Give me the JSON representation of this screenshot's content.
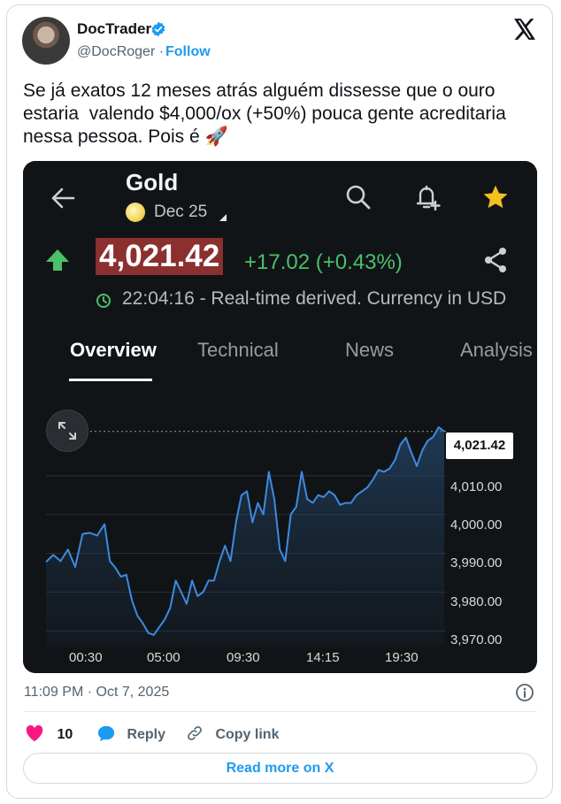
{
  "tweet": {
    "author_name": "DocTrader",
    "handle": "@DocRoger",
    "separator": "·",
    "follow_label": "Follow",
    "text": "Se já exatos 12 meses atrás alguém dissesse que o ouro\nestaria  valendo $4,000/ox (+50%) pouca gente acreditaria\nnessa pessoa. Pois é 🚀",
    "timestamp": "11:09 PM · Oct 7, 2025",
    "likes": "10",
    "reply_label": "Reply",
    "copy_label": "Copy link",
    "read_more_label": "Read more on X",
    "like_color": "#f91880",
    "link_color": "#1d9bf0"
  },
  "app": {
    "asset": "Gold",
    "expiry": "Dec 25",
    "price": "4,021.42",
    "change": "+17.02 (+0.43%)",
    "realtime_text": "22:04:16 - Real-time derived. Currency in USD",
    "tabs": [
      "Overview",
      "Technical",
      "News",
      "Analysis"
    ],
    "active_tab": "Overview",
    "up_color": "#49c06a",
    "price_bg_color": "#8b2f2f",
    "icons": [
      "back-arrow-icon",
      "search-icon",
      "bell-plus-icon",
      "star-icon",
      "share-icon",
      "clock-icon",
      "expand-icon"
    ]
  },
  "chart_data": {
    "type": "area",
    "xlabel": "",
    "ylabel": "",
    "x_ticks": [
      "00:30",
      "05:00",
      "09:30",
      "14:15",
      "19:30"
    ],
    "y_ticks": [
      "3,970.00",
      "3,980.00",
      "3,990.00",
      "4,000.00",
      "4,010.00"
    ],
    "ylim": [
      3966,
      4025
    ],
    "last_value_label": "4,021.42",
    "reference_line": 4021.42,
    "x_hours": [
      0,
      0.4,
      0.8,
      1.2,
      1.6,
      2.0,
      2.4,
      2.8,
      3.2,
      3.5,
      3.8,
      4.1,
      4.4,
      4.7,
      5.0,
      5.3,
      5.6,
      5.9,
      6.2,
      6.5,
      6.8,
      7.1,
      7.4,
      7.7,
      8.0,
      8.3,
      8.6,
      8.9,
      9.2,
      9.5,
      9.8,
      10.1,
      10.4,
      10.7,
      11.0,
      11.3,
      11.6,
      11.9,
      12.2,
      12.5,
      12.8,
      13.1,
      13.4,
      13.7,
      14.0,
      14.3,
      14.6,
      14.9,
      15.2,
      15.5,
      15.8,
      16.1,
      16.4,
      16.7,
      17.0,
      17.3,
      17.6,
      17.9,
      18.2,
      18.5,
      18.8,
      19.1,
      19.4,
      19.7,
      20.0,
      20.3,
      20.6,
      20.9,
      21.2,
      21.5,
      21.8
    ],
    "values": [
      3987.8,
      3989.6,
      3988.0,
      3991.0,
      3986.5,
      3995.0,
      3995.3,
      3994.6,
      3997.5,
      3988.0,
      3986.3,
      3984.0,
      3984.5,
      3978.0,
      3974.0,
      3972.0,
      3969.5,
      3969.0,
      3971.0,
      3973.0,
      3976.0,
      3983.0,
      3980.0,
      3977.0,
      3983.0,
      3979.0,
      3980.0,
      3983.0,
      3983.0,
      3988.0,
      3992.0,
      3988.0,
      3998.0,
      4005.0,
      4006.0,
      3998.0,
      4003.0,
      4000.0,
      4011.0,
      4004.0,
      3991.0,
      3988.0,
      4000.0,
      4002.0,
      4011.0,
      4004.0,
      4003.0,
      4005.0,
      4004.5,
      4006.0,
      4005.0,
      4002.5,
      4003.0,
      4003.0,
      4005.0,
      4006.0,
      4007.0,
      4009.0,
      4011.5,
      4011.0,
      4011.8,
      4014.0,
      4018.0,
      4019.8,
      4016.0,
      4012.5,
      4016.5,
      4019.0,
      4020.0,
      4022.5,
      4021.4
    ],
    "line_color": "#3d8be0",
    "grid": true
  }
}
